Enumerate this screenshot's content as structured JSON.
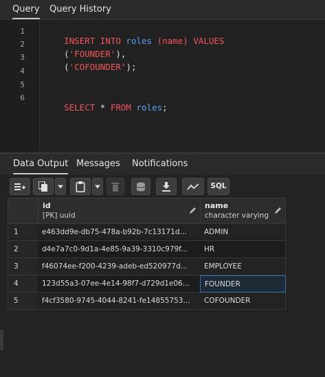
{
  "top_tabs": [
    {
      "label": "Query",
      "active": true
    },
    {
      "label": "Query History",
      "active": false
    }
  ],
  "editor": {
    "lines": [
      {
        "num": "1",
        "tokens": [
          {
            "t": "INSERT INTO ",
            "c": "kw"
          },
          {
            "t": "roles",
            "c": "id"
          },
          {
            "t": " (",
            "c": "kw"
          },
          {
            "t": "name",
            "c": "kw"
          },
          {
            "t": ") VALUES",
            "c": "kw"
          }
        ]
      },
      {
        "num": "2",
        "tokens": [
          {
            "t": "(",
            "c": "pl"
          },
          {
            "t": "'FOUNDER'",
            "c": "st"
          },
          {
            "t": "),",
            "c": "pl"
          }
        ]
      },
      {
        "num": "3",
        "tokens": [
          {
            "t": "(",
            "c": "pl"
          },
          {
            "t": "'COFOUNDER'",
            "c": "st"
          },
          {
            "t": ");",
            "c": "pl"
          }
        ]
      },
      {
        "num": "4",
        "tokens": []
      },
      {
        "num": "5",
        "tokens": []
      },
      {
        "num": "6",
        "tokens": [
          {
            "t": "SELECT ",
            "c": "kw"
          },
          {
            "t": "* ",
            "c": "pl"
          },
          {
            "t": "FROM ",
            "c": "kw"
          },
          {
            "t": "roles",
            "c": "id"
          },
          {
            "t": ";",
            "c": "pl"
          }
        ]
      }
    ]
  },
  "output_tabs": [
    {
      "label": "Data Output",
      "active": true
    },
    {
      "label": "Messages",
      "active": false
    },
    {
      "label": "Notifications",
      "active": false
    }
  ],
  "toolbar": {
    "icons": [
      "add-row-icon",
      "copy-icon",
      "dropdown-icon",
      "paste-icon",
      "dropdown-icon",
      "delete-icon",
      "save-data-icon",
      "download-icon",
      "graph-icon",
      "sql-icon"
    ],
    "sql_label": "SQL"
  },
  "grid": {
    "columns": [
      {
        "name": "id",
        "type": "[PK] uuid"
      },
      {
        "name": "name",
        "type": "character varying"
      }
    ],
    "rows": [
      {
        "num": "1",
        "id": "e463dd9e-db75-478a-b92b-7c13171d...",
        "name": "ADMIN"
      },
      {
        "num": "2",
        "id": "d4e7a7c0-9d1a-4e85-9a39-3310c979f...",
        "name": "HR"
      },
      {
        "num": "3",
        "id": "f46074ee-f200-4239-adeb-ed520977d...",
        "name": "EMPLOYEE"
      },
      {
        "num": "4",
        "id": "123d55a3-07ee-4e14-98f7-d729d1e06...",
        "name": "FOUNDER",
        "selected_cell": "name"
      },
      {
        "num": "5",
        "id": "f4cf3580-9745-4044-8241-fe14855753...",
        "name": "COFOUNDER"
      }
    ]
  },
  "colors": {
    "keyword": "#f3565b",
    "identifier": "#5ba2f3",
    "selection_border": "#3a6fa5"
  }
}
